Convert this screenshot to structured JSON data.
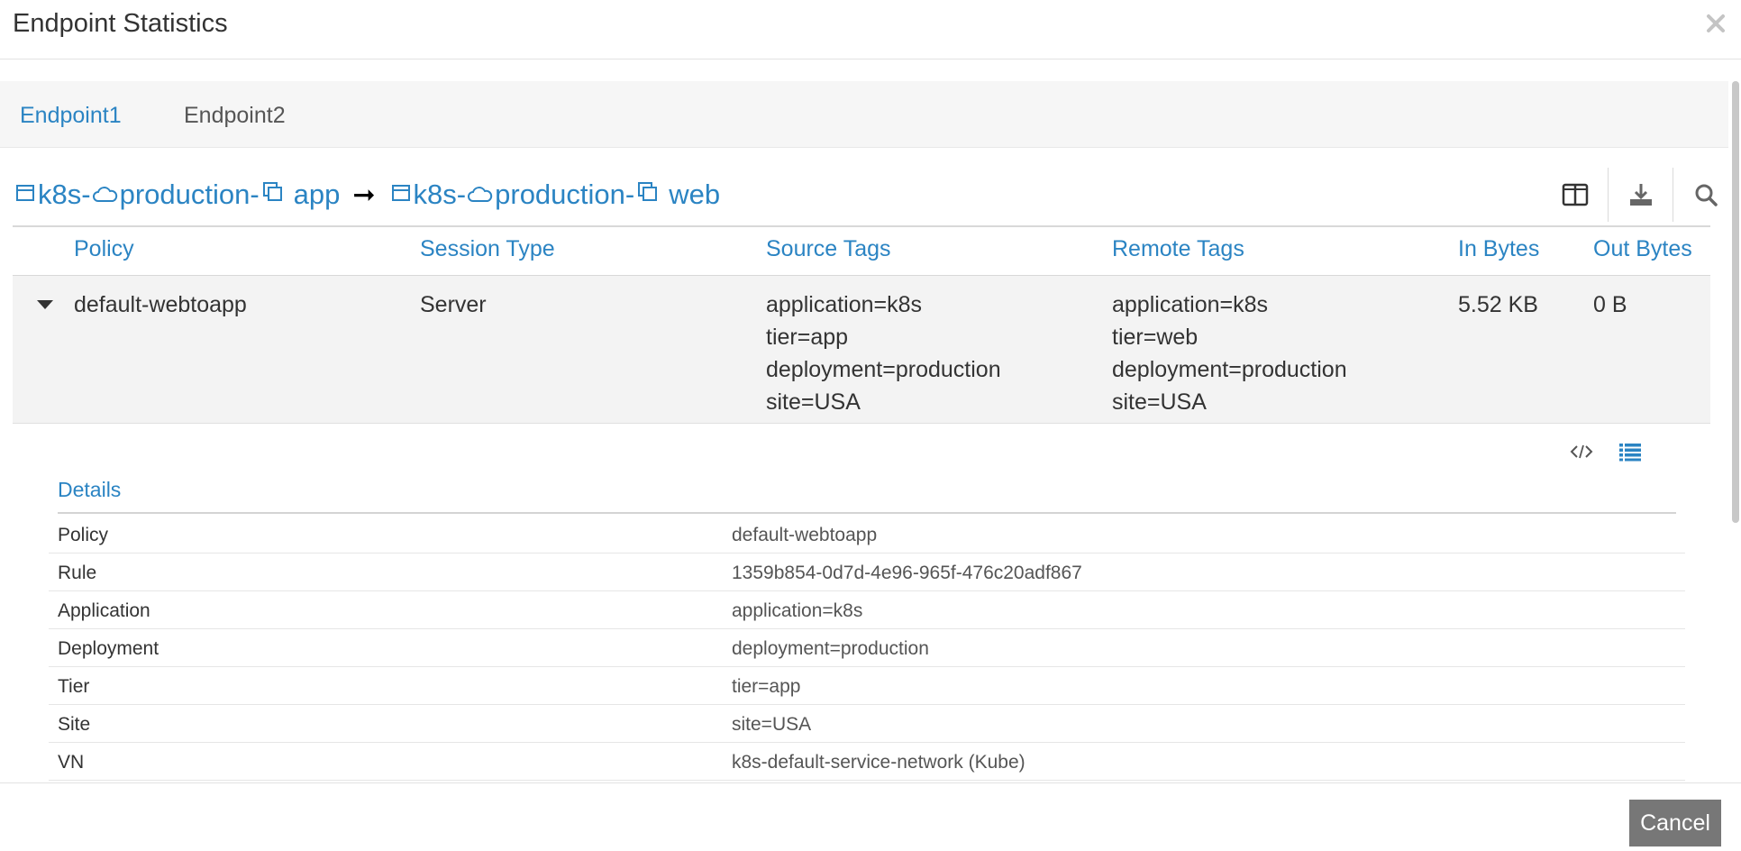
{
  "modal": {
    "title": "Endpoint Statistics",
    "cancel_label": "Cancel"
  },
  "tabs": [
    {
      "label": "Endpoint1",
      "active": true
    },
    {
      "label": "Endpoint2",
      "active": false
    }
  ],
  "grid_title": {
    "source": {
      "prefix": "k8s-",
      "mid": "production-",
      "suffix": "app"
    },
    "arrow": "➞",
    "destination": {
      "prefix": "k8s-",
      "mid": "production-",
      "suffix": "web"
    }
  },
  "toolbar": {
    "icons": [
      "columns-icon",
      "download-icon",
      "search-icon"
    ]
  },
  "table": {
    "headers": [
      "Policy",
      "Session Type",
      "Source Tags",
      "Remote Tags",
      "In Bytes",
      "Out Bytes"
    ],
    "rows": [
      {
        "policy": "default-webtoapp",
        "session_type": "Server",
        "source_tags": [
          "application=k8s",
          "tier=app",
          "deployment=production",
          "site=USA"
        ],
        "remote_tags": [
          "application=k8s",
          "tier=web",
          "deployment=production",
          "site=USA"
        ],
        "in_bytes": "5.52 KB",
        "out_bytes": "0 B"
      }
    ]
  },
  "details": {
    "title": "Details",
    "rows": [
      {
        "key": "Policy",
        "value": "default-webtoapp"
      },
      {
        "key": "Rule",
        "value": "1359b854-0d7d-4e96-965f-476c20adf867"
      },
      {
        "key": "Application",
        "value": "application=k8s"
      },
      {
        "key": "Deployment",
        "value": "deployment=production"
      },
      {
        "key": "Tier",
        "value": "tier=app"
      },
      {
        "key": "Site",
        "value": "site=USA"
      },
      {
        "key": "VN",
        "value": "k8s-default-service-network (Kube)"
      }
    ]
  },
  "colors": {
    "accent": "#2b84c3",
    "row_bg": "#f3f3f3",
    "cancel_bg": "#777777"
  }
}
